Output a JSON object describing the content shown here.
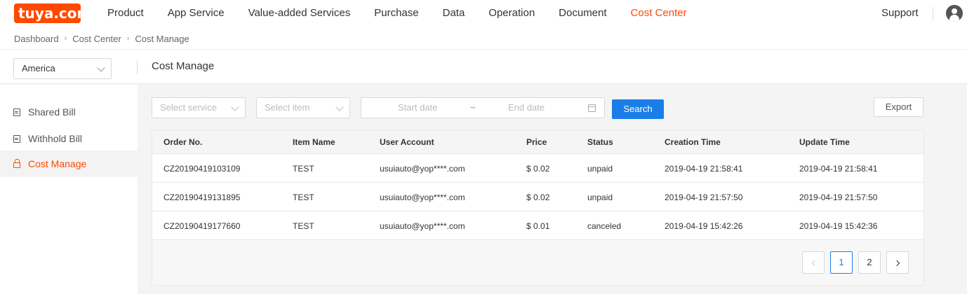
{
  "app": {
    "logo": "tuya.com",
    "nav": [
      "Product",
      "App Service",
      "Value-added Services",
      "Purchase",
      "Data",
      "Operation",
      "Document",
      "Cost Center"
    ],
    "active_nav": "Cost Center",
    "support": "Support",
    "accent": "#ff4800",
    "primary": "#1a7ee8"
  },
  "breadcrumb": [
    "Dashboard",
    "Cost Center",
    "Cost Manage"
  ],
  "region": {
    "selected": "America"
  },
  "page_title": "Cost Manage",
  "sidebar": {
    "items": [
      {
        "label": "Shared Bill",
        "icon": "document-icon"
      },
      {
        "label": "Withhold Bill",
        "icon": "document-icon"
      },
      {
        "label": "Cost Manage",
        "icon": "lock-icon",
        "active": true
      }
    ]
  },
  "filters": {
    "service_placeholder": "Select service",
    "item_placeholder": "Select item",
    "start_date_placeholder": "Start date",
    "date_separator": "~",
    "end_date_placeholder": "End date",
    "search_label": "Search",
    "export_label": "Export"
  },
  "table": {
    "columns": [
      "Order No.",
      "Item Name",
      "User Account",
      "Price",
      "Status",
      "Creation Time",
      "Update Time"
    ],
    "rows": [
      [
        "CZ20190419103109",
        "TEST",
        "usuiauto@yop****.com",
        "$ 0.02",
        "unpaid",
        "2019-04-19 21:58:41",
        "2019-04-19 21:58:41"
      ],
      [
        "CZ20190419131895",
        "TEST",
        "usuiauto@yop****.com",
        "$ 0.02",
        "unpaid",
        "2019-04-19 21:57:50",
        "2019-04-19 21:57:50"
      ],
      [
        "CZ20190419177660",
        "TEST",
        "usuiauto@yop****.com",
        "$ 0.01",
        "canceled",
        "2019-04-19 15:42:26",
        "2019-04-19 15:42:36"
      ]
    ]
  },
  "pagination": {
    "pages": [
      "1",
      "2"
    ],
    "current": "1"
  }
}
